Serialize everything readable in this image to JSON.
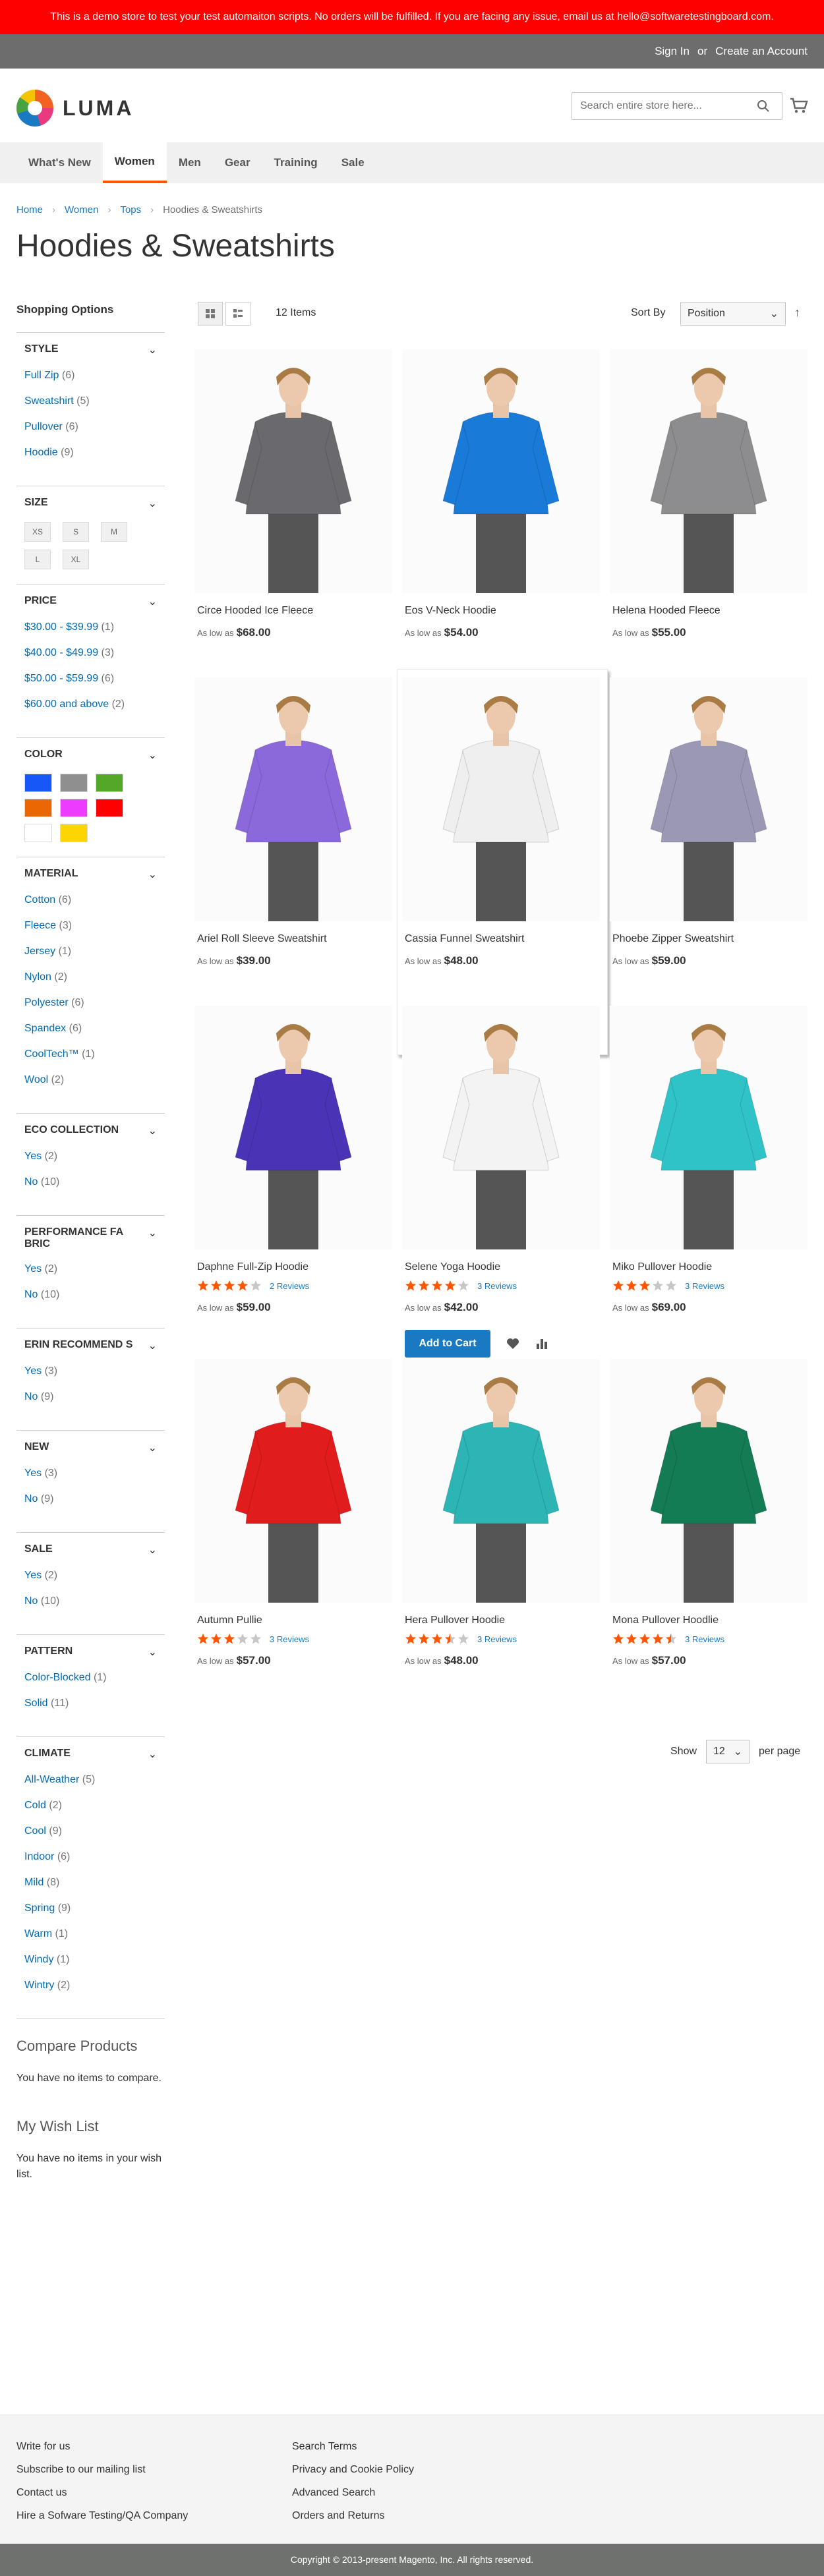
{
  "banner": "This is a demo store to test your test automaiton scripts. No orders will be fulfilled. If you are facing any issue, email us at hello@softwaretestingboard.com.",
  "topbar": {
    "sign_in": "Sign In",
    "or": "or",
    "create": "Create an Account"
  },
  "logo": "LUMA",
  "search": {
    "placeholder": "Search entire store here..."
  },
  "nav": [
    "What's New",
    "Women",
    "Men",
    "Gear",
    "Training",
    "Sale"
  ],
  "breadcrumbs": [
    "Home",
    "Women",
    "Tops",
    "Hoodies & Sweatshirts"
  ],
  "title": "Hoodies & Sweatshirts",
  "sidebar": {
    "heading": "Shopping Options",
    "style": {
      "title": "STYLE",
      "options": [
        {
          "label": "Full Zip",
          "count": "(6)"
        },
        {
          "label": "Sweatshirt",
          "count": "(5)"
        },
        {
          "label": "Pullover",
          "count": "(6)"
        },
        {
          "label": "Hoodie",
          "count": "(9)"
        }
      ]
    },
    "size": {
      "title": "SIZE",
      "options": [
        "XS",
        "S",
        "M",
        "L",
        "XL"
      ]
    },
    "price": {
      "title": "PRICE",
      "options": [
        {
          "label": "$30.00 - $39.99",
          "count": "(1)"
        },
        {
          "label": "$40.00 - $49.99",
          "count": "(3)"
        },
        {
          "label": "$50.00 - $59.99",
          "count": "(6)"
        },
        {
          "label": "$60.00 and above",
          "count": "(2)"
        }
      ]
    },
    "color": {
      "title": "COLOR",
      "swatches": [
        "#1857f7",
        "#8f8f8f",
        "#53a828",
        "#eb6703",
        "#ef3dff",
        "#ff0000",
        "#ffffff",
        "#ffd500"
      ]
    },
    "material": {
      "title": "MATERIAL",
      "options": [
        {
          "label": "Cotton",
          "count": "(6)"
        },
        {
          "label": "Fleece",
          "count": "(3)"
        },
        {
          "label": "Jersey",
          "count": "(1)"
        },
        {
          "label": "Nylon",
          "count": "(2)"
        },
        {
          "label": "Polyester",
          "count": "(6)"
        },
        {
          "label": "Spandex",
          "count": "(6)"
        },
        {
          "label": "CoolTech™",
          "count": "(1)"
        },
        {
          "label": "Wool",
          "count": "(2)"
        }
      ]
    },
    "eco": {
      "title": "ECO COLLECTION",
      "options": [
        {
          "label": "Yes",
          "count": "(2)"
        },
        {
          "label": "No",
          "count": "(10)"
        }
      ]
    },
    "perf": {
      "title": "PERFORMANCE FA BRIC",
      "options": [
        {
          "label": "Yes",
          "count": "(2)"
        },
        {
          "label": "No",
          "count": "(10)"
        }
      ]
    },
    "erin": {
      "title": "ERIN RECOMMEND S",
      "options": [
        {
          "label": "Yes",
          "count": "(3)"
        },
        {
          "label": "No",
          "count": "(9)"
        }
      ]
    },
    "new": {
      "title": "NEW",
      "options": [
        {
          "label": "Yes",
          "count": "(3)"
        },
        {
          "label": "No",
          "count": "(9)"
        }
      ]
    },
    "sale": {
      "title": "SALE",
      "options": [
        {
          "label": "Yes",
          "count": "(2)"
        },
        {
          "label": "No",
          "count": "(10)"
        }
      ]
    },
    "pattern": {
      "title": "PATTERN",
      "options": [
        {
          "label": "Color-Blocked",
          "count": "(1)"
        },
        {
          "label": "Solid",
          "count": "(11)"
        }
      ]
    },
    "climate": {
      "title": "CLIMATE",
      "options": [
        {
          "label": "All-Weather",
          "count": "(5)"
        },
        {
          "label": "Cold",
          "count": "(2)"
        },
        {
          "label": "Cool",
          "count": "(9)"
        },
        {
          "label": "Indoor",
          "count": "(6)"
        },
        {
          "label": "Mild",
          "count": "(8)"
        },
        {
          "label": "Spring",
          "count": "(9)"
        },
        {
          "label": "Warm",
          "count": "(1)"
        },
        {
          "label": "Windy",
          "count": "(1)"
        },
        {
          "label": "Wintry",
          "count": "(2)"
        }
      ]
    },
    "compare": {
      "title": "Compare Products",
      "body": "You have no items to compare."
    },
    "wishlist": {
      "title": "My Wish List",
      "body": "You have no items in your wish list."
    }
  },
  "toolbar": {
    "count": "12 Items",
    "sort_label": "Sort By",
    "sort_value": "Position"
  },
  "products": [
    {
      "name": "Circe Hooded Ice Fleece",
      "price_label": "As low as",
      "price": "$68.00",
      "color": "#6a6a6e"
    },
    {
      "name": "Eos V-Neck Hoodie",
      "price_label": "As low as",
      "price": "$54.00",
      "color": "#1a7ad8"
    },
    {
      "name": "Helena Hooded Fleece",
      "price_label": "As low as",
      "price": "$55.00",
      "color": "#8d8d8f"
    },
    {
      "name": "Ariel Roll Sleeve Sweatshirt",
      "price_label": "As low as",
      "price": "$39.00",
      "color": "#8b69db"
    },
    {
      "name": "Cassia Funnel Sweatshirt",
      "price_label": "As low as",
      "price": "$48.00",
      "color": "#efefef"
    },
    {
      "name": "Phoebe Zipper Sweatshirt",
      "price_label": "As low as",
      "price": "$59.00",
      "color": "#9a98b4"
    },
    {
      "name": "Daphne Full-Zip Hoodie",
      "rating": 4,
      "reviews": "2 Reviews",
      "price_label": "As low as",
      "price": "$59.00",
      "color": "#4a34b5"
    },
    {
      "name": "Selene Yoga Hoodie",
      "rating": 4,
      "reviews": "3 Reviews",
      "price_label": "As low as",
      "price": "$42.00",
      "color": "#f3f3f3"
    },
    {
      "name": "Miko Pullover Hoodie",
      "rating": 3,
      "reviews": "3 Reviews",
      "price_label": "As low as",
      "price": "$69.00",
      "color": "#2fc3c8"
    },
    {
      "name": "Autumn Pullie",
      "rating": 3,
      "reviews": "3 Reviews",
      "price_label": "As low as",
      "price": "$57.00",
      "color": "#e01c1c"
    },
    {
      "name": "Hera Pullover Hoodie",
      "rating": 3.5,
      "reviews": "3 Reviews",
      "price_label": "As low as",
      "price": "$48.00",
      "color": "#2db4b5"
    },
    {
      "name": "Mona Pullover Hoodlie",
      "rating": 4.5,
      "reviews": "3 Reviews",
      "price_label": "As low as",
      "price": "$57.00",
      "color": "#137c54"
    }
  ],
  "add_to_cart": "Add to Cart",
  "limiter": {
    "show": "Show",
    "value": "12",
    "per_page": "per page"
  },
  "footer": {
    "col1": [
      "Write for us",
      "Subscribe to our mailing list",
      "Contact us",
      "Hire a Sofware Testing/QA Company"
    ],
    "col2": [
      "Search Terms",
      "Privacy and Cookie Policy",
      "Advanced Search",
      "Orders and Returns"
    ],
    "copyright": "Copyright © 2013-present Magento, Inc. All rights reserved."
  },
  "colors": {
    "accent": "#1979c3",
    "nav_active": "#ff5501",
    "star": "#ff5501",
    "banner": "#ff0000"
  }
}
